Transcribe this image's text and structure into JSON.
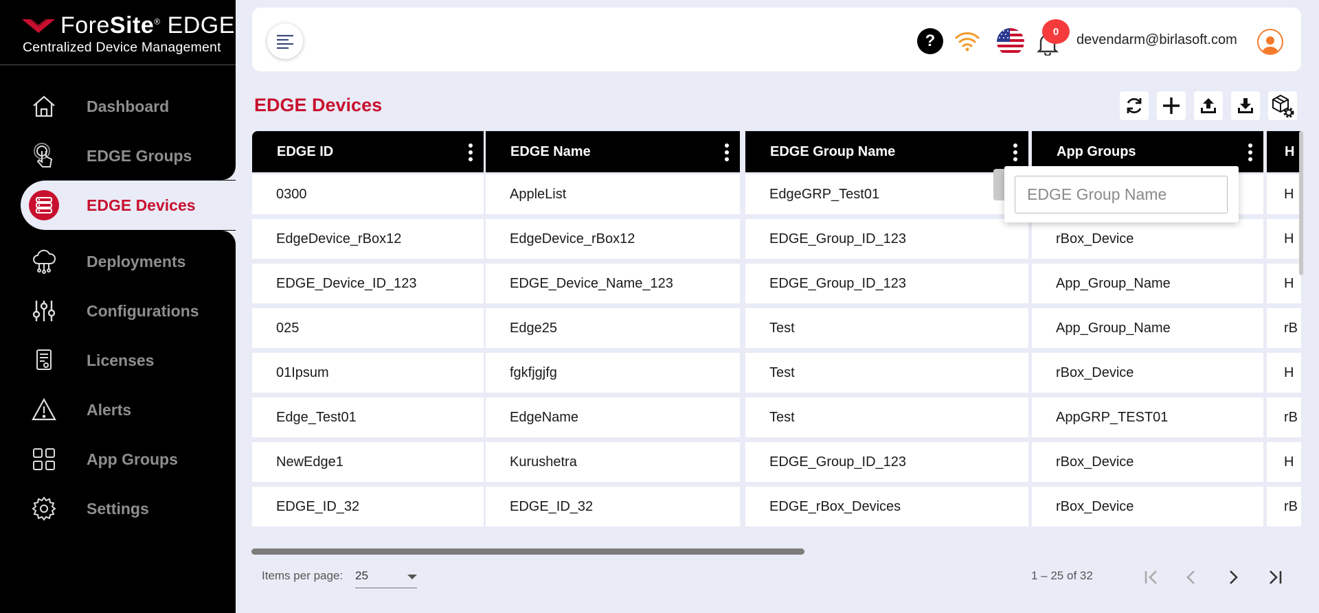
{
  "brand": {
    "name_light": "Fore",
    "name_bold": "Site",
    "trademark": "®",
    "product": " EDGE",
    "subtitle": "Centralized Device Management",
    "accent_color": "#c8102e"
  },
  "sidebar": {
    "items": [
      {
        "label": "Dashboard",
        "icon": "home-icon"
      },
      {
        "label": "EDGE Groups",
        "icon": "touch-icon"
      },
      {
        "label": "EDGE Devices",
        "icon": "server-icon",
        "active": true
      },
      {
        "label": "Deployments",
        "icon": "cloud-network-icon"
      },
      {
        "label": "Configurations",
        "icon": "sliders-icon"
      },
      {
        "label": "Licenses",
        "icon": "license-icon"
      },
      {
        "label": "Alerts",
        "icon": "warning-icon"
      },
      {
        "label": "App Groups",
        "icon": "grid-icon"
      },
      {
        "label": "Settings",
        "icon": "gear-icon"
      }
    ]
  },
  "header": {
    "help_label": "?",
    "notification_count": "0",
    "user_email": "devendarm@birlasoft.com"
  },
  "page": {
    "title": "EDGE Devices"
  },
  "table": {
    "columns": [
      "EDGE ID",
      "EDGE Name",
      "EDGE Group Name",
      "App Groups",
      "H"
    ],
    "rows": [
      [
        "0300",
        "AppleList",
        "EdgeGRP_Test01",
        "",
        "H"
      ],
      [
        "EdgeDevice_rBox12",
        "EdgeDevice_rBox12",
        "EDGE_Group_ID_123",
        "rBox_Device",
        "H"
      ],
      [
        "EDGE_Device_ID_123",
        "EDGE_Device_Name_123",
        "EDGE_Group_ID_123",
        "App_Group_Name",
        "H"
      ],
      [
        "025",
        "Edge25",
        "Test",
        "App_Group_Name",
        "rB"
      ],
      [
        "01Ipsum",
        "fgkfjgjfg",
        "Test",
        "rBox_Device",
        "H"
      ],
      [
        "Edge_Test01",
        "EdgeName",
        "Test",
        "AppGRP_TEST01",
        "rB"
      ],
      [
        "NewEdge1",
        "Kurushetra",
        "EDGE_Group_ID_123",
        "rBox_Device",
        "H"
      ],
      [
        "EDGE_ID_32",
        "EDGE_ID_32",
        "EDGE_rBox_Devices",
        "rBox_Device",
        "rB"
      ]
    ]
  },
  "filter_popup": {
    "placeholder": "EDGE Group Name"
  },
  "paginator": {
    "items_per_page_label": "Items per page:",
    "items_per_page_value": "25",
    "range_label": "1 – 25 of 32"
  }
}
